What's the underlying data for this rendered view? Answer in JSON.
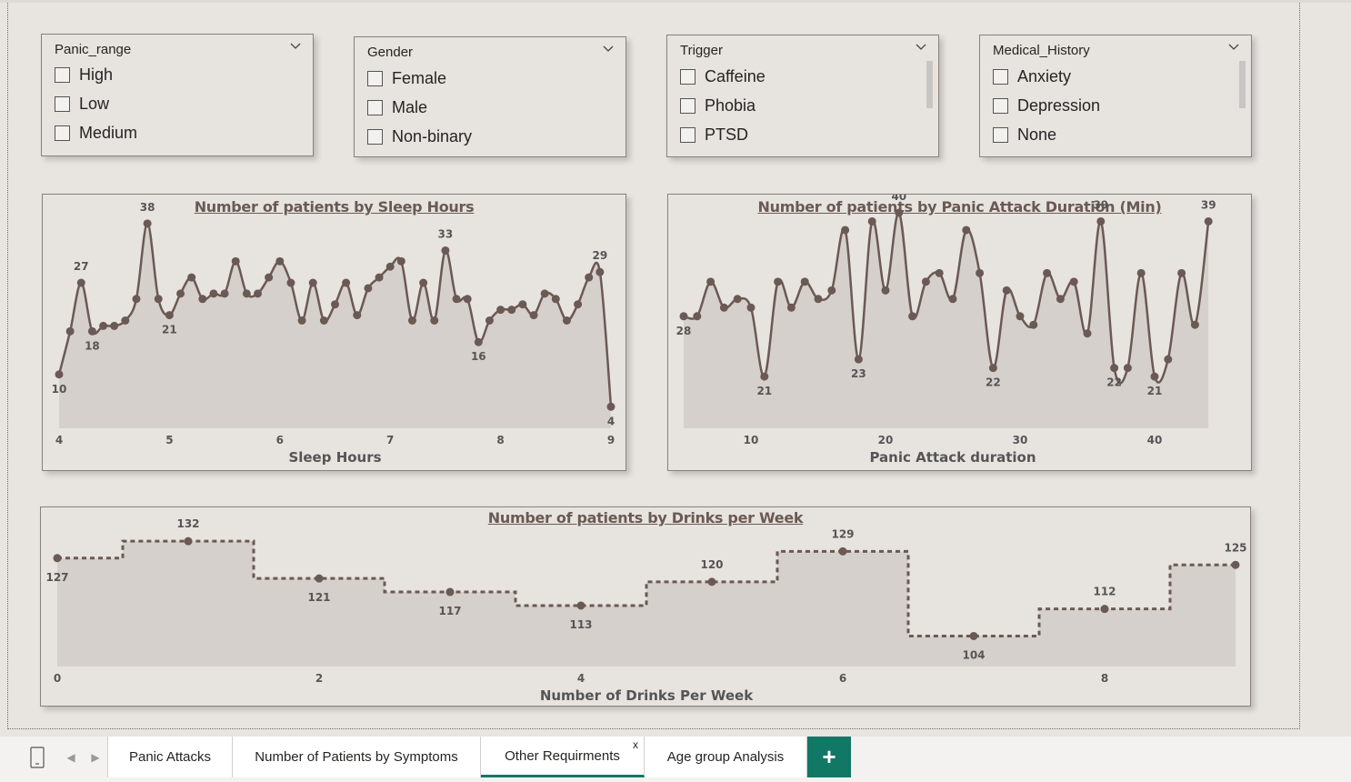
{
  "slicers": [
    {
      "title": "Panic_range",
      "options": [
        "High",
        "Low",
        "Medium"
      ],
      "scroll": false
    },
    {
      "title": "Gender",
      "options": [
        "Female",
        "Male",
        "Non-binary"
      ],
      "scroll": false
    },
    {
      "title": "Trigger",
      "options": [
        "Caffeine",
        "Phobia",
        "PTSD"
      ],
      "scroll": true
    },
    {
      "title": "Medical_History",
      "options": [
        "Anxiety",
        "Depression",
        "None"
      ],
      "scroll": true
    }
  ],
  "tabs": {
    "tab1": "Panic Attacks",
    "tab2": "Number of Patients by Symptoms",
    "tab3": "Other Requirments",
    "tab3_close": "x",
    "tab4": "Age group Analysis",
    "add": "+"
  },
  "colors": {
    "line": "#6b5954",
    "fill": "#d6d0cc",
    "accent": "#117865"
  },
  "chart_data": [
    {
      "type": "area",
      "title": "Number of patients by Sleep Hours",
      "xlabel": "Sleep Hours",
      "ylabel": "",
      "xlim": [
        4,
        9
      ],
      "ylim": [
        0,
        40
      ],
      "xticks": [
        4,
        5,
        6,
        7,
        8,
        9
      ],
      "x": [
        4.0,
        4.1,
        4.2,
        4.3,
        4.4,
        4.5,
        4.6,
        4.7,
        4.8,
        4.9,
        5.0,
        5.1,
        5.2,
        5.3,
        5.4,
        5.5,
        5.6,
        5.7,
        5.8,
        5.9,
        6.0,
        6.1,
        6.2,
        6.3,
        6.4,
        6.5,
        6.6,
        6.7,
        6.8,
        6.9,
        7.0,
        7.1,
        7.2,
        7.3,
        7.4,
        7.5,
        7.6,
        7.7,
        7.8,
        7.9,
        8.0,
        8.1,
        8.2,
        8.3,
        8.4,
        8.5,
        8.6,
        8.7,
        8.8,
        8.9,
        9.0
      ],
      "y": [
        10,
        18,
        27,
        18,
        19,
        19,
        20,
        24,
        38,
        24,
        21,
        25,
        28,
        24,
        25,
        25,
        31,
        25,
        25,
        28,
        31,
        27,
        20,
        27,
        20,
        23,
        27,
        21,
        26,
        28,
        30,
        31,
        20,
        27,
        20,
        33,
        24,
        24,
        16,
        20,
        22,
        22,
        23,
        21,
        25,
        24,
        20,
        23,
        28,
        29,
        4
      ],
      "data_labels": [
        {
          "x": 4.0,
          "text": "10"
        },
        {
          "x": 4.2,
          "text": "27"
        },
        {
          "x": 4.3,
          "text": "18"
        },
        {
          "x": 4.8,
          "text": "38"
        },
        {
          "x": 5.0,
          "text": "21"
        },
        {
          "x": 7.5,
          "text": "33"
        },
        {
          "x": 7.8,
          "text": "16"
        },
        {
          "x": 8.9,
          "text": "29"
        },
        {
          "x": 9.0,
          "text": "4"
        }
      ]
    },
    {
      "type": "area",
      "title": "Number of patients by Panic Attack Duration (Min)",
      "xlabel": "Panic Attack duration",
      "ylabel": "",
      "xlim": [
        5,
        45
      ],
      "ylim": [
        15,
        40
      ],
      "xticks": [
        10,
        20,
        30,
        40
      ],
      "x": [
        5,
        6,
        7,
        8,
        9,
        10,
        11,
        12,
        13,
        14,
        15,
        16,
        17,
        18,
        19,
        20,
        21,
        22,
        23,
        24,
        25,
        26,
        27,
        28,
        29,
        30,
        31,
        32,
        33,
        34,
        35,
        36,
        37,
        38,
        39,
        40,
        41,
        42,
        43,
        44
      ],
      "y": [
        28,
        28,
        32,
        29,
        30,
        29,
        21,
        32,
        29,
        32,
        30,
        31,
        38,
        23,
        39,
        31,
        40,
        28,
        32,
        33,
        30,
        38,
        33,
        22,
        31,
        28,
        27,
        33,
        30,
        32,
        26,
        39,
        22,
        22,
        33,
        21,
        23,
        33,
        27,
        39
      ],
      "data_labels": [
        {
          "x": 5,
          "text": "28"
        },
        {
          "x": 11,
          "text": "21"
        },
        {
          "x": 18,
          "text": "23"
        },
        {
          "x": 21,
          "text": "40"
        },
        {
          "x": 28,
          "text": "22"
        },
        {
          "x": 36,
          "text": "39"
        },
        {
          "x": 37,
          "text": "22"
        },
        {
          "x": 40,
          "text": "21"
        },
        {
          "x": 44,
          "text": "39"
        }
      ]
    },
    {
      "type": "area",
      "title": "Number of patients by Drinks per Week",
      "xlabel": "Number of Drinks Per Week",
      "ylabel": "",
      "step": true,
      "xlim": [
        0,
        9
      ],
      "ylim": [
        95,
        135
      ],
      "xticks": [
        0,
        2,
        4,
        6,
        8
      ],
      "x": [
        0,
        1,
        2,
        3,
        4,
        5,
        6,
        7,
        8,
        9
      ],
      "y": [
        127,
        132,
        121,
        117,
        113,
        120,
        129,
        104,
        112,
        125
      ]
    }
  ]
}
